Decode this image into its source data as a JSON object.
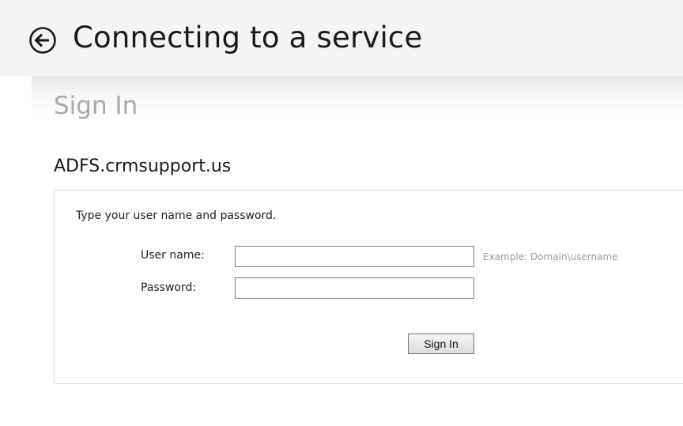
{
  "header": {
    "title": "Connecting to a service",
    "back_icon": "back-arrow-circle-icon"
  },
  "page": {
    "heading": "Sign In",
    "domain": "ADFS.crmsupport.us"
  },
  "form": {
    "instruction": "Type your user name and password.",
    "username_label": "User name:",
    "username_value": "",
    "username_hint": "Example: Domain\\username",
    "password_label": "Password:",
    "password_value": "",
    "submit_label": "Sign In"
  }
}
